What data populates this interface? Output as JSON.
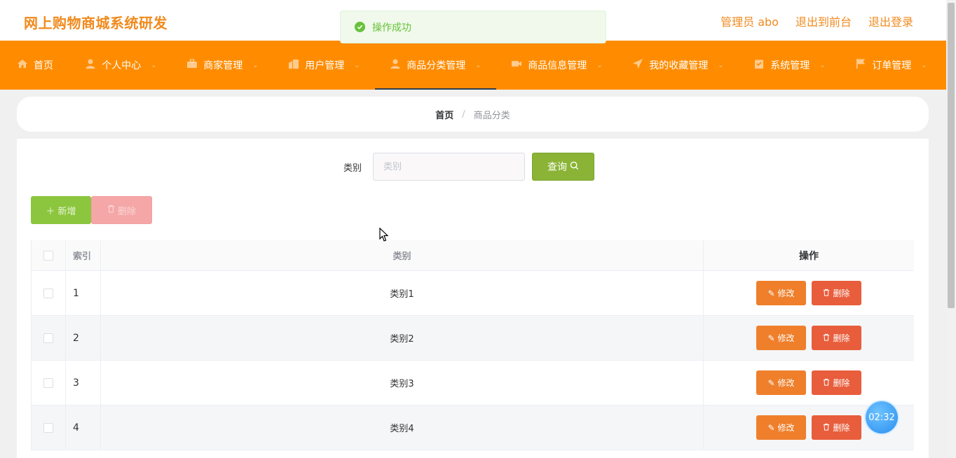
{
  "header": {
    "site_title": "网上购物商城系统研发",
    "links": [
      "管理员 abo",
      "退出到前台",
      "退出登录"
    ]
  },
  "toast": {
    "message": "操作成功"
  },
  "nav": {
    "items": [
      {
        "label": "首页",
        "icon": "home-icon",
        "dropdown": false
      },
      {
        "label": "个人中心",
        "icon": "user-icon",
        "dropdown": true
      },
      {
        "label": "商家管理",
        "icon": "briefcase-icon",
        "dropdown": true
      },
      {
        "label": "用户管理",
        "icon": "building-icon",
        "dropdown": true
      },
      {
        "label": "商品分类管理",
        "icon": "user-icon",
        "dropdown": true,
        "active": true
      },
      {
        "label": "商品信息管理",
        "icon": "video-icon",
        "dropdown": true
      },
      {
        "label": "我的收藏管理",
        "icon": "location-arrow-icon",
        "dropdown": true
      },
      {
        "label": "系统管理",
        "icon": "clipboard-icon",
        "dropdown": true
      },
      {
        "label": "订单管理",
        "icon": "flag-icon",
        "dropdown": true
      }
    ]
  },
  "breadcrumb": {
    "home": "首页",
    "separator": "/",
    "current": "商品分类"
  },
  "search": {
    "label": "类别",
    "placeholder": "类别",
    "value": "",
    "button": "查询"
  },
  "actions": {
    "add": "新增",
    "delete": "删除"
  },
  "table": {
    "columns": [
      "索引",
      "类别",
      "操作"
    ],
    "rows": [
      {
        "index": "1",
        "category": "类别1"
      },
      {
        "index": "2",
        "category": "类别2"
      },
      {
        "index": "3",
        "category": "类别3"
      },
      {
        "index": "4",
        "category": "类别4"
      }
    ],
    "row_actions": {
      "edit": "修改",
      "delete": "删除"
    }
  },
  "timer": {
    "text": "02:32"
  },
  "colors": {
    "accent": "#ff8c00",
    "title": "#f08a1d",
    "query": "#8bb437",
    "add": "#8cc63f",
    "edit": "#ef7f2b",
    "delete": "#e85d3c"
  }
}
